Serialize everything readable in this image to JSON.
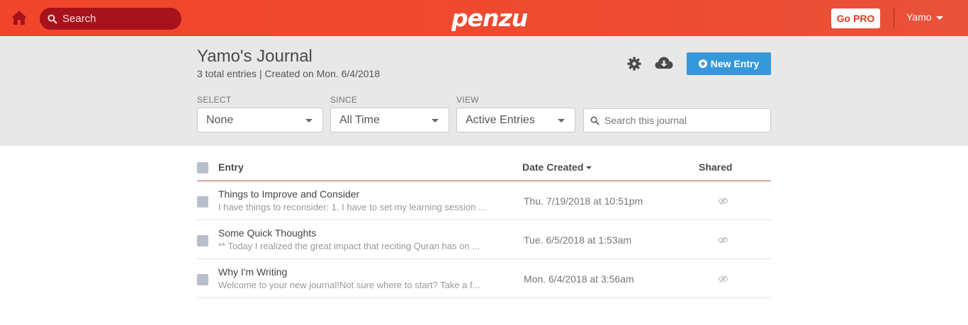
{
  "topbar": {
    "search_placeholder": "Search",
    "logo_text": "penzu",
    "gopro_label": "Go PRO",
    "user_label": "Yamo",
    "home_icon": "home-icon",
    "brand_color": "#f1452b"
  },
  "journal": {
    "title": "Yamo's Journal",
    "subtitle": "3 total entries | Created on Mon. 6/4/2018",
    "new_entry_label": "New Entry",
    "accent_color": "#3598db"
  },
  "filters": {
    "select": {
      "label": "SELECT",
      "value": "None"
    },
    "since": {
      "label": "SINCE",
      "value": "All Time"
    },
    "view": {
      "label": "VIEW",
      "value": "Active Entries"
    },
    "search_placeholder": "Search this journal"
  },
  "table": {
    "headers": {
      "entry": "Entry",
      "date": "Date Created",
      "shared": "Shared"
    },
    "rows": [
      {
        "title": "Things to Improve and Consider",
        "excerpt": "I have things to reconsider: 1. I have to set my learning session ...",
        "date": "Thu. 7/19/2018 at 10:51pm"
      },
      {
        "title": "Some Quick Thoughts",
        "excerpt": "** Today I realized the great impact that reciting Quran has on ...",
        "date": "Tue. 6/5/2018 at 1:53am"
      },
      {
        "title": "Why I'm Writing",
        "excerpt": "Welcome to your new journal!Not sure where to start? Take a f...",
        "date": "Mon. 6/4/2018 at 3:56am"
      }
    ]
  }
}
